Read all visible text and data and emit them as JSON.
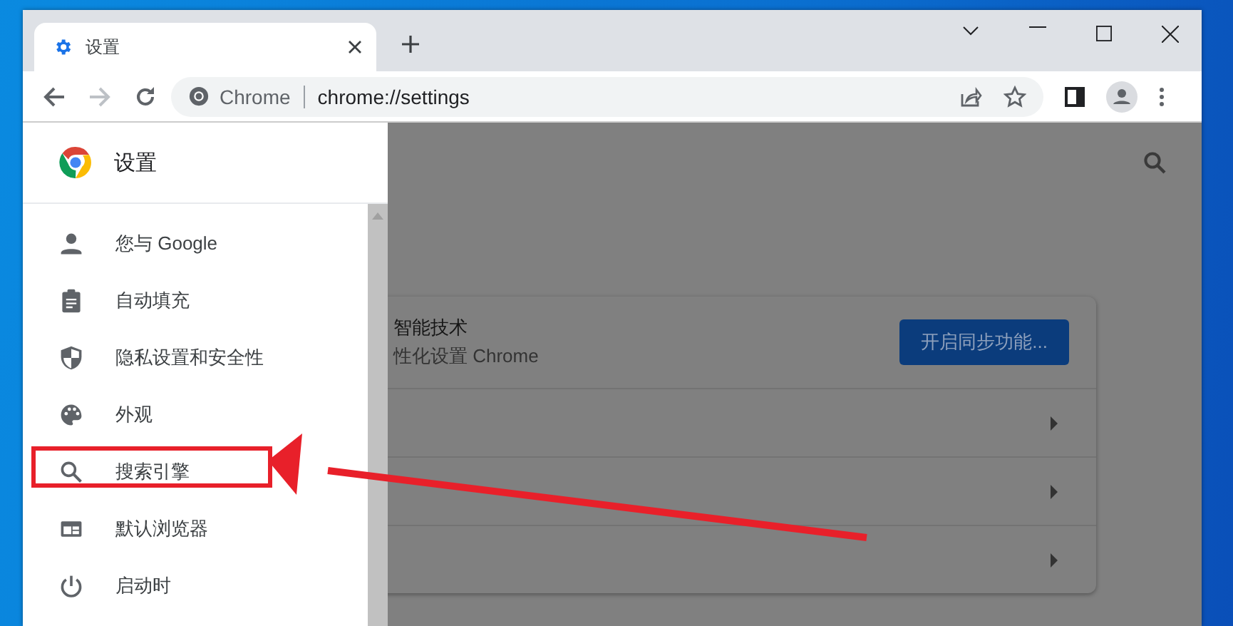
{
  "tab": {
    "title": "设置",
    "selected": true
  },
  "address_bar": {
    "chip": "Chrome",
    "url": "chrome://settings"
  },
  "sidebar": {
    "title": "设置",
    "items": [
      {
        "label": "您与 Google"
      },
      {
        "label": "自动填充"
      },
      {
        "label": "隐私设置和安全性"
      },
      {
        "label": "外观"
      },
      {
        "label": "搜索引擎"
      },
      {
        "label": "默认浏览器"
      },
      {
        "label": "启动时"
      }
    ]
  },
  "card": {
    "title": "智能技术",
    "subtitle": "性化设置 Chrome",
    "button": "开启同步功能..."
  }
}
